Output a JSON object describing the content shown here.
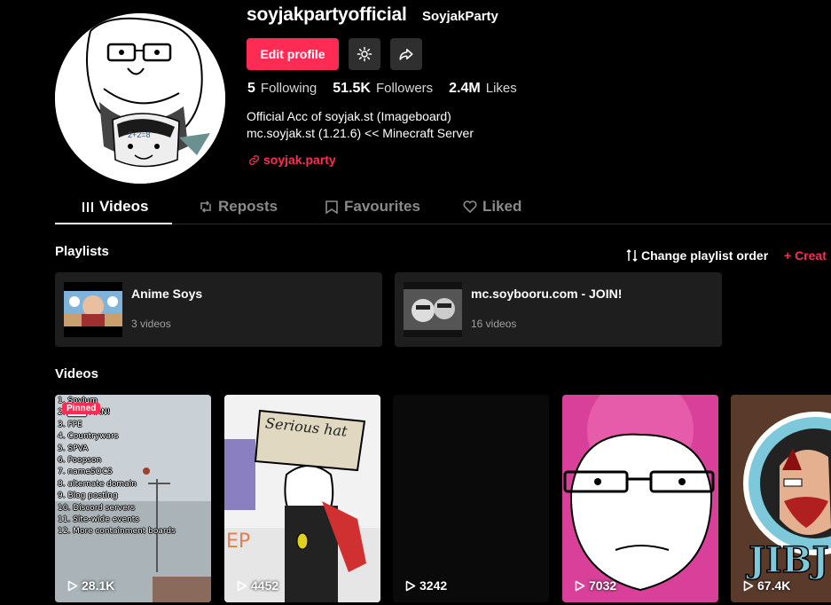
{
  "profile": {
    "username": "soyjakpartyofficial",
    "nickname": "SoyjakParty",
    "edit_label": "Edit profile",
    "stats": [
      {
        "num": "5",
        "label": "Following"
      },
      {
        "num": "51.5K",
        "label": "Followers"
      },
      {
        "num": "2.4M",
        "label": "Likes"
      }
    ],
    "bio_line1": "Official Acc of soyjak.st (Imageboard)",
    "bio_line2": "mc.soyjak.st (1.21.6) << Minecraft Server",
    "link": "soyjak.party"
  },
  "tabs": [
    "Videos",
    "Reposts",
    "Favourites",
    "Liked"
  ],
  "playlists": {
    "title": "Playlists",
    "change_order": "Change playlist order",
    "create": "+ Creat",
    "items": [
      {
        "name": "Anime Soys",
        "count": "3 videos"
      },
      {
        "name": "mc.soybooru.com - JOIN!",
        "count": "16 videos"
      }
    ]
  },
  "videos": {
    "title": "Videos",
    "pinned_label": "Pinned",
    "first_list": "1. Soylum\n2. ███ MAN!\n3. FPE\n4. Countrywars\n5. SPVA\n6. Poopson\n7. nameSOCS\n8. alternate domain\n9. Blog posting\n10. Discord servers\n11. Site-wide events\n12. More containment boards",
    "hat_text": "Serious hat",
    "items": [
      {
        "views": "28.1K"
      },
      {
        "views": "4452"
      },
      {
        "views": "3242"
      },
      {
        "views": "7032"
      },
      {
        "views": "67.4K"
      }
    ]
  },
  "colors": {
    "accent": "#fe2c55",
    "bg": "#000000",
    "card": "#1e1e1e"
  }
}
